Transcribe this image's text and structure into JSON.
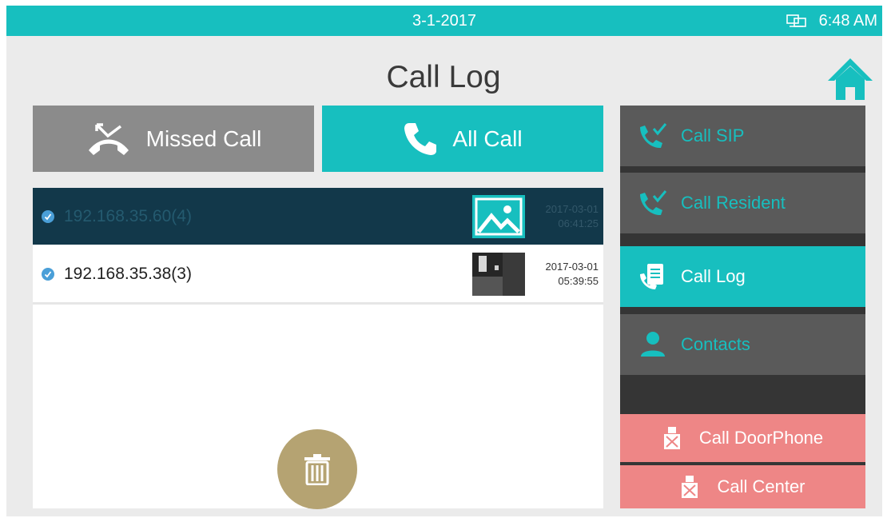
{
  "status_bar": {
    "date": "3-1-2017",
    "time": "6:48 AM",
    "icon": "network-icon"
  },
  "header": {
    "title": "Call Log",
    "home_icon": "home-icon"
  },
  "filters": {
    "missed_label": "Missed Call",
    "missed_icon": "missed-call-icon",
    "all_label": "All Call",
    "all_icon": "phone-icon",
    "selected": "All Call"
  },
  "log": {
    "entries": [
      {
        "address": "192.168.35.60(4)",
        "date": "2017-03-01",
        "time": "06:41:25",
        "thumbnail": "image-placeholder-icon",
        "selected": true
      },
      {
        "address": "192.168.35.38(3)",
        "date": "2017-03-01",
        "time": "05:39:55",
        "thumbnail": "camera-snapshot",
        "selected": false
      }
    ],
    "delete_icon": "trash-icon"
  },
  "menu": {
    "items": [
      {
        "label": "Call SIP",
        "icon": "call-sip-icon"
      },
      {
        "label": "Call Resident",
        "icon": "call-resident-icon"
      },
      {
        "label": "Call Log",
        "icon": "call-log-icon",
        "active": true
      },
      {
        "label": "Contacts",
        "icon": "contacts-icon"
      }
    ],
    "doorphone_label": "Call DoorPhone",
    "center_label": "Call Center"
  },
  "colors": {
    "accent": "#17bfbf",
    "selected_row": "#12384a",
    "menu_dark": "#5a5a5a",
    "pink": "#ee8686",
    "trash": "#b5a372"
  }
}
